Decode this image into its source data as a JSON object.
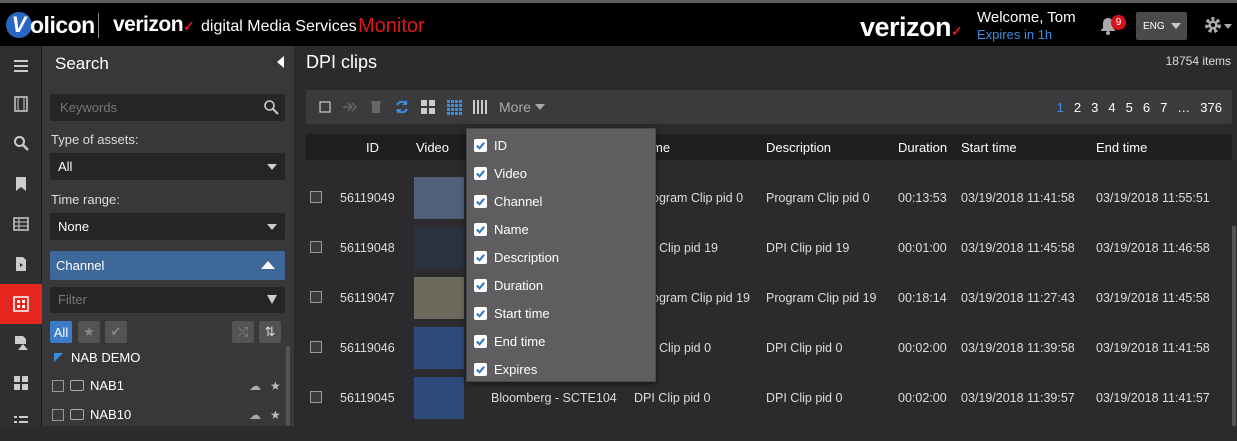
{
  "header": {
    "brand_v": "V",
    "brand": "olicon",
    "verizon_small": "verizon",
    "check_mark": "✓",
    "subtitle": "digital Media Services",
    "app_name": "Monitor",
    "verizon_big": "verizon",
    "welcome": "Welcome, Tom",
    "expires": "Expires in 1h",
    "notification_count": "9",
    "language": "ENG"
  },
  "search_panel": {
    "title": "Search",
    "keywords_placeholder": "Keywords",
    "type_label": "Type of assets:",
    "type_value": "All",
    "time_label": "Time range:",
    "time_value": "None",
    "channel_header": "Channel",
    "filter_placeholder": "Filter",
    "all_button": "All",
    "tree": [
      {
        "label": "NAB DEMO"
      },
      {
        "label": "NAB1"
      },
      {
        "label": "NAB10"
      }
    ]
  },
  "main": {
    "title": "DPI clips",
    "item_count": "18754 items",
    "more_label": "More",
    "pages": [
      "1",
      "2",
      "3",
      "4",
      "5",
      "6",
      "7",
      "…",
      "376"
    ],
    "columns": {
      "id": "ID",
      "video": "Video",
      "name": "me",
      "description": "Description",
      "duration": "Duration",
      "start": "Start time",
      "end": "End time"
    },
    "rows": [
      {
        "id": "56119049",
        "channel": "",
        "name": "ogram Clip pid 0",
        "description": "Program Clip pid 0",
        "duration": "00:13:53",
        "start": "03/19/2018 11:41:58",
        "end": "03/19/2018 11:55:51"
      },
      {
        "id": "56119048",
        "channel": "",
        "name": "I Clip pid 19",
        "description": "DPI Clip pid 19",
        "duration": "00:01:00",
        "start": "03/19/2018 11:45:58",
        "end": "03/19/2018 11:46:58"
      },
      {
        "id": "56119047",
        "channel": "",
        "name": "ogram Clip pid 19",
        "description": "Program Clip pid 19",
        "duration": "00:18:14",
        "start": "03/19/2018 11:27:43",
        "end": "03/19/2018 11:45:58"
      },
      {
        "id": "56119046",
        "channel": "",
        "name": "I Clip pid 0",
        "description": "DPI Clip pid 0",
        "duration": "00:02:00",
        "start": "03/19/2018 11:39:58",
        "end": "03/19/2018 11:41:58"
      },
      {
        "id": "56119045",
        "channel": "Bloomberg - SCTE104",
        "name": "DPI Clip pid 0",
        "description": "DPI Clip pid 0",
        "duration": "00:02:00",
        "start": "03/19/2018 11:39:57",
        "end": "03/19/2018 11:41:57"
      }
    ]
  },
  "columns_menu": [
    {
      "label": "ID",
      "checked": true
    },
    {
      "label": "Video",
      "checked": true
    },
    {
      "label": "Channel",
      "checked": true
    },
    {
      "label": "Name",
      "checked": true
    },
    {
      "label": "Description",
      "checked": true
    },
    {
      "label": "Duration",
      "checked": true
    },
    {
      "label": "Start time",
      "checked": true
    },
    {
      "label": "End time",
      "checked": true
    },
    {
      "label": "Expires",
      "checked": true
    }
  ],
  "colors": {
    "accent_red": "#e0161b",
    "accent_blue": "#3b8de0",
    "channel_header": "#3d6899"
  },
  "icons": [
    "menu-icon",
    "film-icon",
    "search-icon",
    "bookmark-icon",
    "table-icon",
    "file-icon",
    "grid-icon",
    "alert-doc-icon",
    "tiles-icon",
    "list-icon",
    "bell-icon",
    "gear-icon"
  ]
}
